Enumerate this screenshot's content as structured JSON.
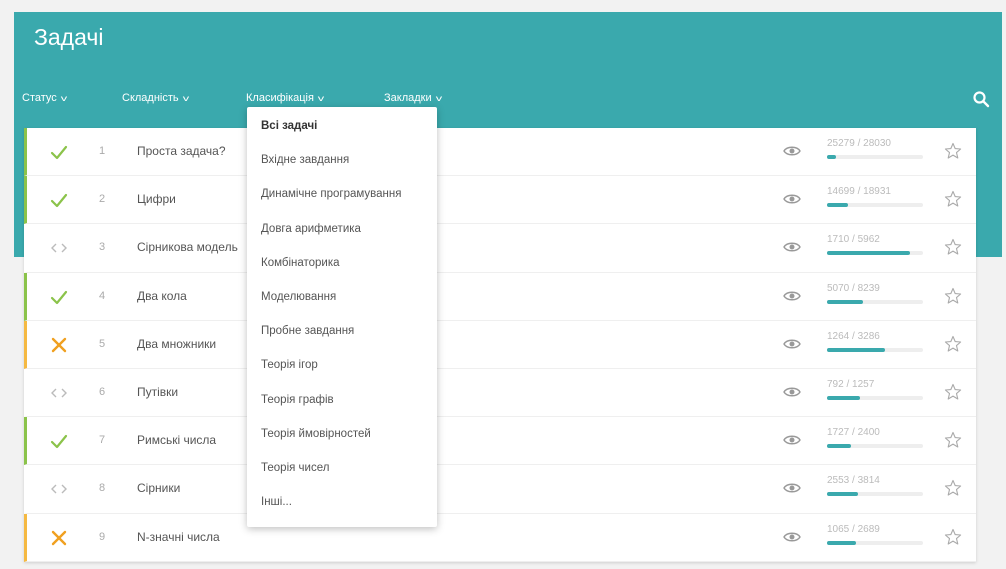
{
  "header": {
    "title": "Задачі",
    "accent": "#3aa9ad"
  },
  "filters": [
    {
      "label": "Статус"
    },
    {
      "label": "Складність"
    },
    {
      "label": "Класифікація"
    },
    {
      "label": "Закладки"
    }
  ],
  "dropdown": {
    "items": [
      "Всі задачі",
      "Вхідне завдання",
      "Динамічне програмування",
      "Довга арифметика",
      "Комбінаторика",
      "Моделювання",
      "Пробне завдання",
      "Теорія ігор",
      "Теорія графів",
      "Теорія ймовірностей",
      "Теорія чисел",
      "Інші..."
    ]
  },
  "problems": [
    {
      "status": "solved",
      "num": "1",
      "name": "Проста задача?",
      "stats": "25279 / 28030",
      "progress": 0.09
    },
    {
      "status": "solved",
      "num": "2",
      "name": "Цифри",
      "stats": "14699 / 18931",
      "progress": 0.22
    },
    {
      "status": "none",
      "num": "3",
      "name": "Сірникова модель",
      "stats": "1710 / 5962",
      "progress": 0.86
    },
    {
      "status": "solved",
      "num": "4",
      "name": "Два кола",
      "stats": "5070 / 8239",
      "progress": 0.38
    },
    {
      "status": "failed",
      "num": "5",
      "name": "Два множники",
      "stats": "1264 / 3286",
      "progress": 0.6
    },
    {
      "status": "none",
      "num": "6",
      "name": "Путівки",
      "stats": "792 / 1257",
      "progress": 0.34
    },
    {
      "status": "solved",
      "num": "7",
      "name": "Римські числа",
      "stats": "1727 / 2400",
      "progress": 0.25
    },
    {
      "status": "none",
      "num": "8",
      "name": "Сірники",
      "stats": "2553 / 3814",
      "progress": 0.32
    },
    {
      "status": "failed",
      "num": "9",
      "name": "N-значні числа",
      "stats": "1065 / 2689",
      "progress": 0.3
    }
  ],
  "icons": {
    "solved": "check-icon",
    "failed": "cross-icon",
    "none": "code-icon",
    "view": "eye-icon",
    "bookmark": "star-icon",
    "search": "search-icon"
  }
}
